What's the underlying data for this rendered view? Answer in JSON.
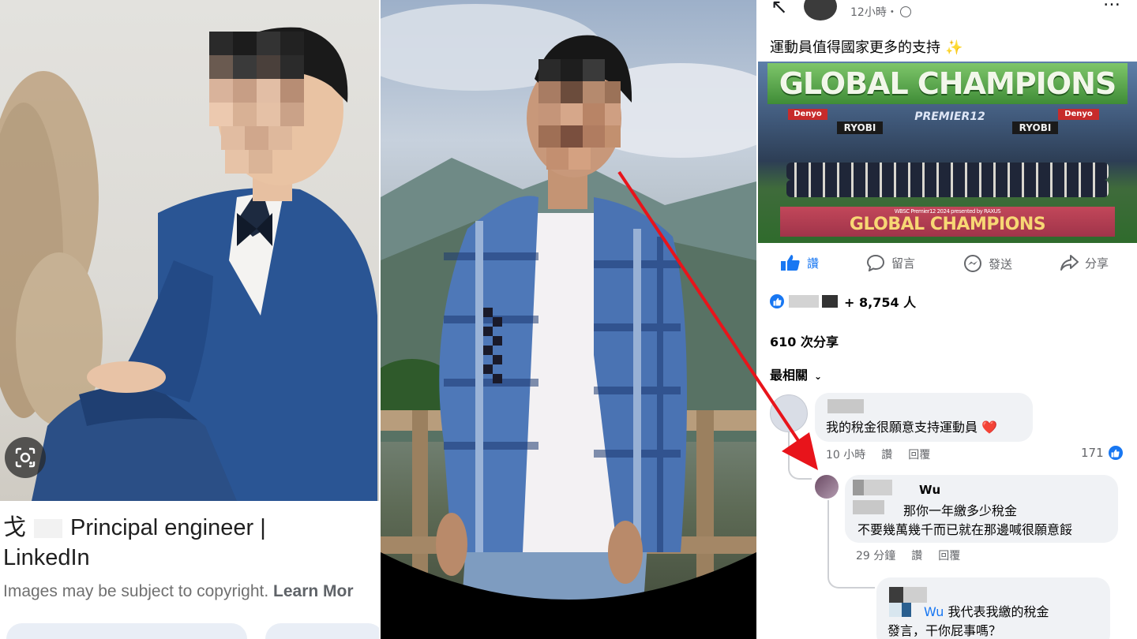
{
  "left_result": {
    "title_surname": "戈",
    "title_text": "Principal engineer |",
    "title_line2": "LinkedIn",
    "copyright_text": "Images may be subject to copyright.",
    "learn_more": "Learn Mor"
  },
  "post": {
    "time": "12小時・",
    "text": "運動員值得國家更多的支持",
    "sparkle": "✨",
    "image": {
      "banner_top": "GLOBAL CHAMPIONS",
      "premier": "PREMIER12",
      "sponsor_denyo": "Denyo",
      "sponsor_ryobi": "RYOBI",
      "sign_sub": "WBSC Premier12 2024 presented by RAXUS",
      "sign_main": "GLOBAL CHAMPIONS"
    },
    "actions": {
      "like": "讚",
      "comment": "留言",
      "send": "發送",
      "share": "分享"
    },
    "reactions_count": "+ 8,754 人",
    "shares": "610 次分享",
    "sort_label": "最相關"
  },
  "comments": [
    {
      "text": "我的稅金很願意支持運動員",
      "emoji": "❤️",
      "time": "10 小時",
      "like": "讚",
      "reply": "回覆",
      "likes": "171"
    },
    {
      "name": "Wu",
      "line1": "那你一年繳多少稅金",
      "line2": "不要幾萬幾千而已就在那邊喊很願意餒",
      "time": "29 分鐘",
      "like": "讚",
      "reply": "回覆"
    },
    {
      "mention": "Wu",
      "line1": "我代表我繳的稅金",
      "line2": "發言，干你屁事嗎？"
    }
  ],
  "colors": {
    "fb_blue": "#1877f2",
    "arrow_red": "#e8141b",
    "bubble_gray": "#f0f2f5"
  }
}
